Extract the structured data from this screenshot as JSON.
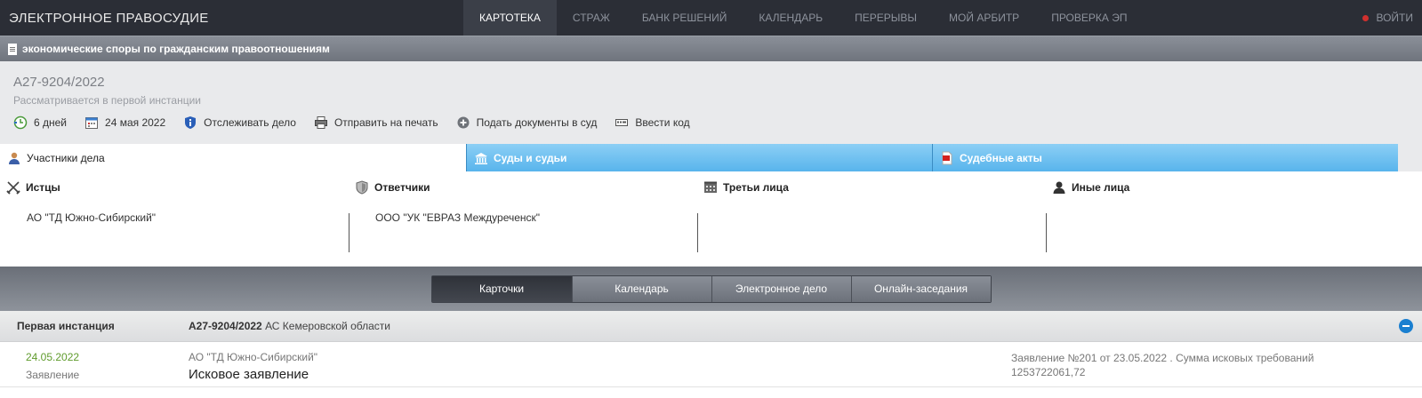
{
  "header": {
    "brand": "ЭЛЕКТРОННОЕ ПРАВОСУДИЕ",
    "nav": [
      "КАРТОТЕКА",
      "СТРАЖ",
      "БАНК РЕШЕНИЙ",
      "КАЛЕНДАРЬ",
      "ПЕРЕРЫВЫ",
      "МОЙ АРБИТР",
      "ПРОВЕРКА ЭП"
    ],
    "login": "ВОЙТИ"
  },
  "category": "экономические споры по гражданским правоотношениям",
  "case": {
    "number": "А27-9204/2022",
    "status": "Рассматривается в первой инстанции",
    "actions": {
      "days": "6 дней",
      "date": "24 мая 2022",
      "track": "Отслеживать дело",
      "print": "Отправить на печать",
      "submit": "Подать документы в суд",
      "code": "Ввести код"
    }
  },
  "tabs": {
    "participants": "Участники дела",
    "courts": "Суды и судьи",
    "acts": "Судебные акты"
  },
  "parties": {
    "plaintiffs": {
      "label": "Истцы",
      "value": "АО \"ТД Южно-Сибирский\""
    },
    "defendants": {
      "label": "Ответчики",
      "value": "ООО \"УК \"ЕВРАЗ Междуреченск\""
    },
    "third": {
      "label": "Третьи лица",
      "value": ""
    },
    "other": {
      "label": "Иные лица",
      "value": ""
    }
  },
  "views": [
    "Карточки",
    "Календарь",
    "Электронное дело",
    "Онлайн-заседания"
  ],
  "instance": {
    "label": "Первая инстанция",
    "case_number": "А27-9204/2022",
    "court": " АС Кемеровской области"
  },
  "entry": {
    "date": "24.05.2022",
    "type": "Заявление",
    "party": "АО \"ТД Южно-Сибирский\"",
    "title": "Исковое заявление",
    "description": "Заявление №201 от 23.05.2022 . Сумма исковых требований 1253722061,72"
  },
  "colors": {
    "accent_blue": "#58b4ec",
    "date_green": "#5f9b2c",
    "alert_red": "#d0302e"
  }
}
